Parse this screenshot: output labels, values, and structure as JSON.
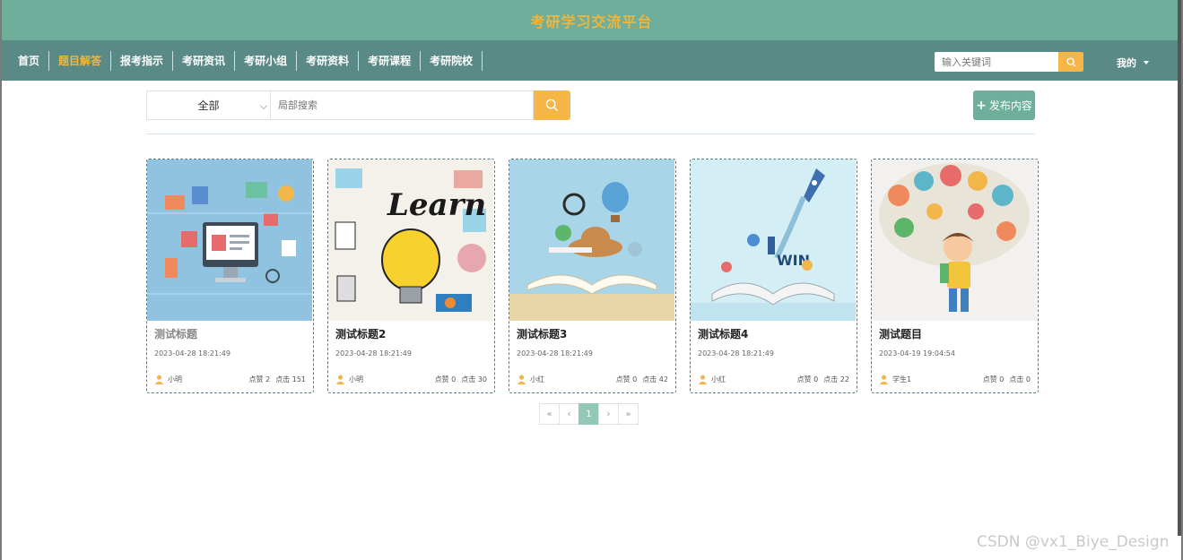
{
  "header": {
    "title": "考研学习交流平台"
  },
  "nav": {
    "items": [
      "首页",
      "题目解答",
      "报考指示",
      "考研资讯",
      "考研小组",
      "考研资料",
      "考研课程",
      "考研院校"
    ],
    "active_index": 1,
    "search_placeholder": "输入关键词",
    "mine_label": "我的"
  },
  "filter": {
    "select_value": "全部",
    "search_placeholder": "局部搜索",
    "publish_label": "发布内容"
  },
  "cards": [
    {
      "title": "测试标题",
      "date": "2023-04-28 18:21:49",
      "author": "小明",
      "likes": "点赞 2",
      "clicks": "点击 151",
      "image": "tech-illustration"
    },
    {
      "title": "测试标题2",
      "date": "2023-04-28 18:21:49",
      "author": "小明",
      "likes": "点赞 0",
      "clicks": "点击 30",
      "image": "learn-lightbulb"
    },
    {
      "title": "测试标题3",
      "date": "2023-04-28 18:21:49",
      "author": "小红",
      "likes": "点赞 0",
      "clicks": "点击 42",
      "image": "book-balloon"
    },
    {
      "title": "测试标题4",
      "date": "2023-04-28 18:21:49",
      "author": "小红",
      "likes": "点赞 0",
      "clicks": "点击 22",
      "image": "book-rocket"
    },
    {
      "title": "测试题目",
      "date": "2023-04-19 19:04:54",
      "author": "学生1",
      "likes": "点赞 0",
      "clicks": "点击 0",
      "image": "boy-thought-bubble"
    }
  ],
  "pagination": {
    "first": "«",
    "prev": "‹",
    "current": "1",
    "next": "›",
    "last": "»"
  },
  "watermark": "CSDN @vx1_Biye_Design",
  "colors": {
    "header_bg": "#6eae9a",
    "nav_bg": "#5a8a86",
    "accent": "#f5b547",
    "card_border": "#4e7f86"
  }
}
